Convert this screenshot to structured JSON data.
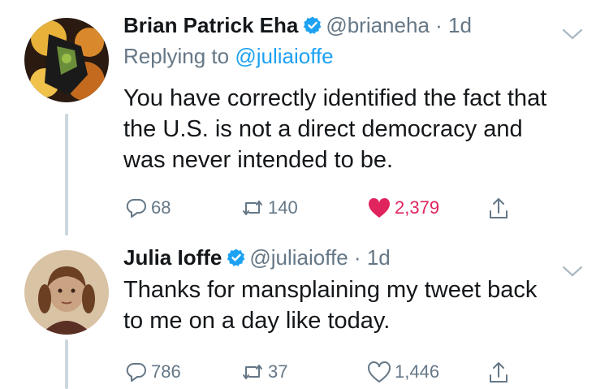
{
  "tweets": [
    {
      "name": "Brian Patrick Eha",
      "handle": "@brianeha",
      "dot": "·",
      "time": "1d",
      "replying_prefix": "Replying to",
      "replying_to": "@juliaioffe",
      "text_lines": [
        "You have correctly identified the fact that",
        "the U.S. is not a direct democracy and",
        "was never intended to be."
      ],
      "replies": "68",
      "retweets": "140",
      "likes": "2,379",
      "liked": true
    },
    {
      "name": "Julia Ioffe",
      "handle": "@juliaioffe",
      "dot": "·",
      "time": "1d",
      "text_lines": [
        "Thanks for mansplaining my tweet back",
        "to me on a day like today."
      ],
      "replies": "786",
      "retweets": "37",
      "likes": "1,446",
      "liked": false
    }
  ],
  "icons": [
    "verified-icon",
    "chevron-down-icon",
    "reply-icon",
    "retweet-icon",
    "like-icon",
    "share-icon"
  ],
  "colors": {
    "accent": "#1da1f2",
    "like": "#e0245e",
    "secondary": "#657786",
    "thread_line": "#ccd6dd"
  }
}
